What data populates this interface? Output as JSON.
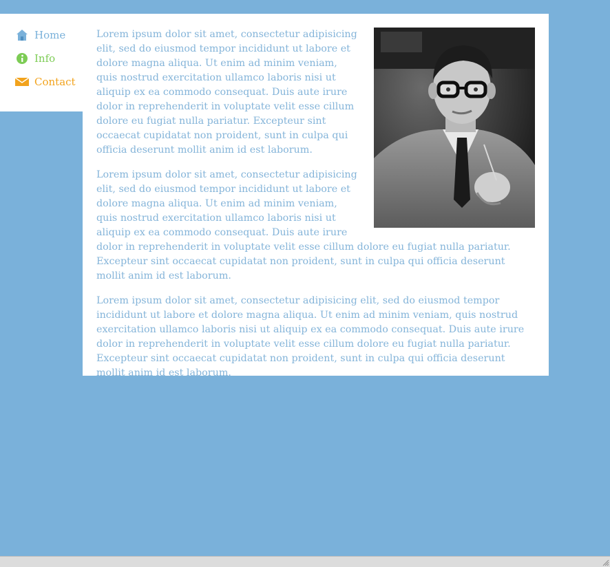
{
  "nav": {
    "items": [
      {
        "label": "Home",
        "icon": "home-icon",
        "color": "#7ab1da"
      },
      {
        "label": "Info",
        "icon": "info-icon",
        "color": "#7dcc55"
      },
      {
        "label": "Contact",
        "icon": "mail-icon",
        "color": "#f2a31d"
      }
    ]
  },
  "content": {
    "paragraphs": [
      "Lorem ipsum dolor sit amet, consectetur adipisicing elit, sed do eiusmod tempor incididunt ut labore et dolore magna aliqua. Ut enim ad minim veniam, quis nostrud exercitation ullamco laboris nisi ut aliquip ex ea commodo consequat. Duis aute irure dolor in reprehenderit in voluptate velit esse cillum dolore eu fugiat nulla pariatur. Excepteur sint occaecat cupidatat non proident, sunt in culpa qui officia deserunt mollit anim id est laborum.",
      "Lorem ipsum dolor sit amet, consectetur adipisicing elit, sed do eiusmod tempor incididunt ut labore et dolore magna aliqua. Ut enim ad minim veniam, quis nostrud exercitation ullamco laboris nisi ut aliquip ex ea commodo consequat. Duis aute irure dolor in reprehenderit in voluptate velit esse cillum dolore eu fugiat nulla pariatur. Excepteur sint occaecat cupidatat non proident, sunt in culpa qui officia deserunt mollit anim id est laborum.",
      "Lorem ipsum dolor sit amet, consectetur adipisicing elit, sed do eiusmod tempor incididunt ut labore et dolore magna aliqua. Ut enim ad minim veniam, quis nostrud exercitation ullamco laboris nisi ut aliquip ex ea commodo consequat. Duis aute irure dolor in reprehenderit in voluptate velit esse cillum dolore eu fugiat nulla pariatur. Excepteur sint occaecat cupidatat non proident, sunt in culpa qui officia deserunt mollit anim id est laborum."
    ]
  },
  "colors": {
    "background": "#7ab1da",
    "panel": "#ffffff",
    "text": "#84b4d9"
  }
}
